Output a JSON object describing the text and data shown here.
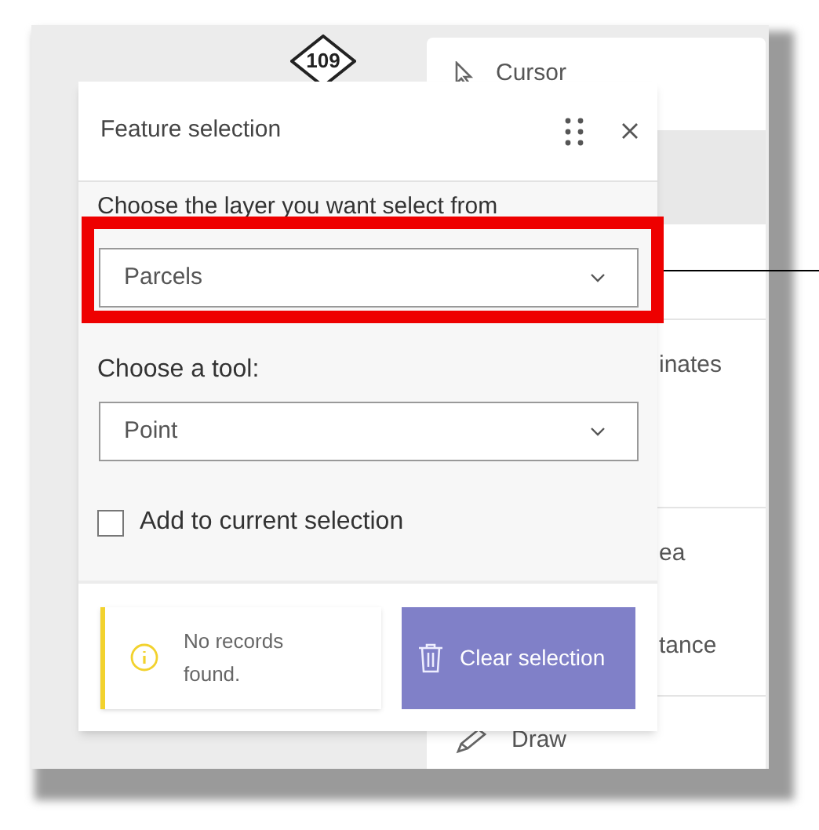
{
  "map": {
    "route_sign": "109"
  },
  "tool_menu": {
    "items": [
      {
        "label": "Cursor",
        "kind": "cursor"
      },
      {
        "label": "inates",
        "kind": "text"
      },
      {
        "label": "ea",
        "kind": "text"
      },
      {
        "label": "tance",
        "kind": "text"
      },
      {
        "label": "Draw",
        "kind": "pencil"
      }
    ]
  },
  "dialog": {
    "title": "Feature selection",
    "layer_label": "Choose the layer you want select from",
    "layer_select": {
      "value": "Parcels",
      "highlighted": true
    },
    "tool_label": "Choose a tool:",
    "tool_select": {
      "value": "Point"
    },
    "checkbox": {
      "label": "Add to current selection",
      "checked": false
    },
    "notice": "No records found.",
    "clear_button": "Clear selection"
  }
}
